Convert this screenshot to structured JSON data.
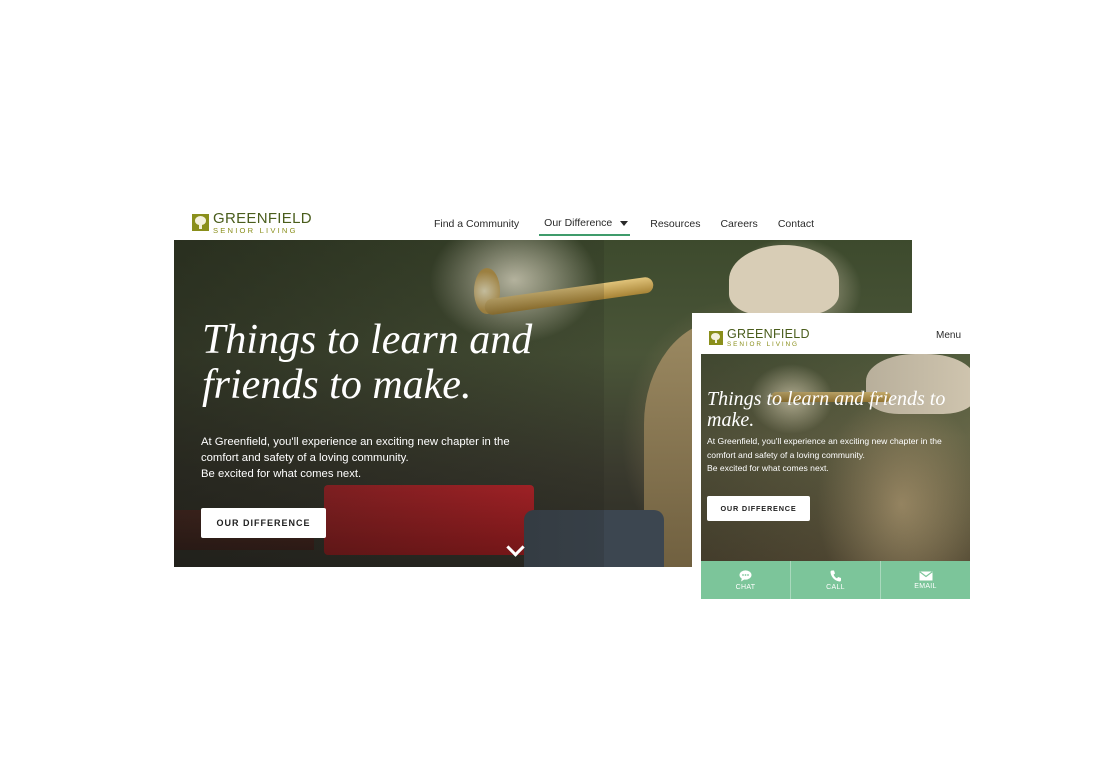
{
  "brand": {
    "name": "GREENFIELD",
    "tagline": "SENIOR LIVING",
    "colors": {
      "logo_green": "#8a8f1b",
      "text_green": "#4a5d1c",
      "accent": "#3f9b6b",
      "action_bar": "#7cc59a"
    }
  },
  "desktop": {
    "nav": [
      {
        "label": "Find a Community"
      },
      {
        "label": "Our Difference",
        "active": true,
        "has_dropdown": true
      },
      {
        "label": "Resources"
      },
      {
        "label": "Careers"
      },
      {
        "label": "Contact"
      }
    ],
    "hero": {
      "title": "Things to learn and friends to make.",
      "subtitle_line1": "At Greenfield, you'll experience an exciting new chapter in the",
      "subtitle_line2": "comfort and safety of a loving community.",
      "subtitle_line3": "Be excited for what comes next.",
      "cta_label": "OUR DIFFERENCE",
      "scroll_icon": "chevron-down-icon"
    }
  },
  "mobile": {
    "menu_label": "Menu",
    "hero": {
      "title": "Things to learn and friends to make.",
      "subtitle_line1": "At Greenfield, you'll experience an exciting new chapter in the",
      "subtitle_line2": "comfort and safety of a loving community.",
      "subtitle_line3": "Be excited for what comes next.",
      "cta_label": "OUR DIFFERENCE"
    },
    "actions": [
      {
        "label": "CHAT",
        "icon": "chat-bubble-icon"
      },
      {
        "label": "CALL",
        "icon": "phone-icon"
      },
      {
        "label": "EMAIL",
        "icon": "envelope-icon"
      }
    ]
  }
}
